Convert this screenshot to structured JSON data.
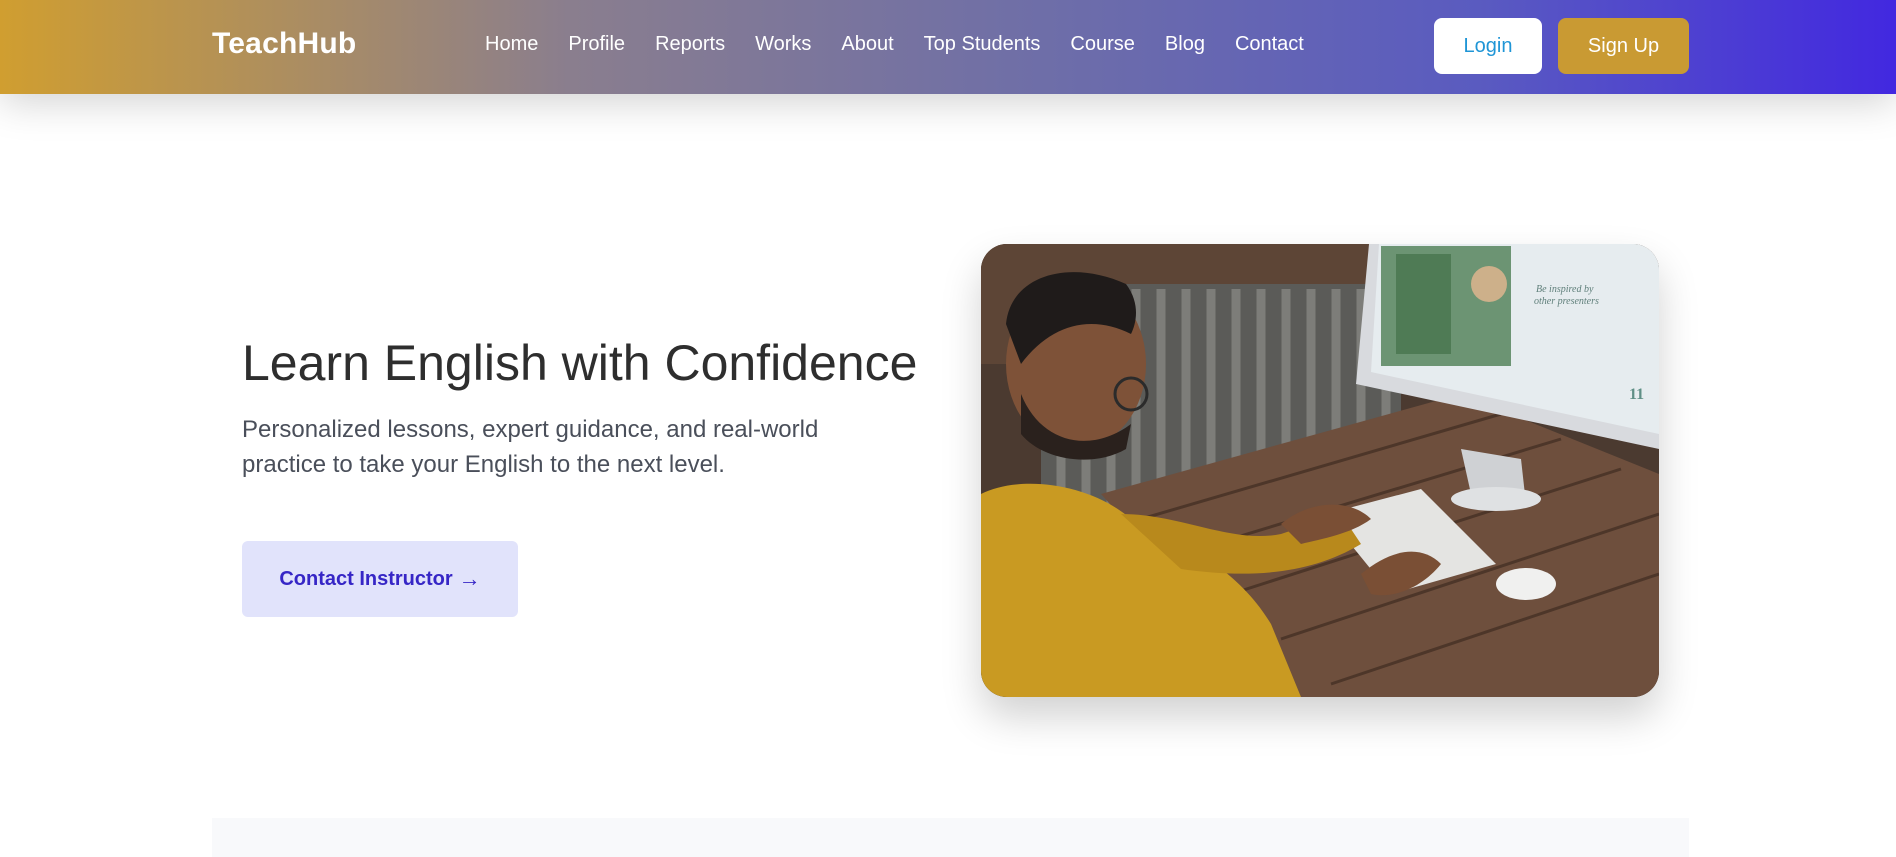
{
  "header": {
    "brand": "TeachHub",
    "nav": [
      {
        "label": "Home"
      },
      {
        "label": "Profile"
      },
      {
        "label": "Reports"
      },
      {
        "label": "Works"
      },
      {
        "label": "About"
      },
      {
        "label": "Top Students"
      },
      {
        "label": "Course"
      },
      {
        "label": "Blog"
      },
      {
        "label": "Contact"
      }
    ],
    "login_label": "Login",
    "signup_label": "Sign Up"
  },
  "hero": {
    "title": "Learn English with Confidence",
    "subtitle": "Personalized lessons, expert guidance, and real-world practice to take your English to the next level.",
    "cta_label": "Contact Instructor",
    "cta_icon": "arrow-right-icon",
    "image_screen_text": "Be inspired by other presenters",
    "image_screen_number": "11"
  },
  "colors": {
    "gradient_start": "#d09e30",
    "gradient_end": "#4228e0",
    "signup_bg": "#c99a33",
    "login_text": "#1f95d6",
    "cta_bg": "#e1e3fb",
    "cta_text": "#3626c6"
  }
}
